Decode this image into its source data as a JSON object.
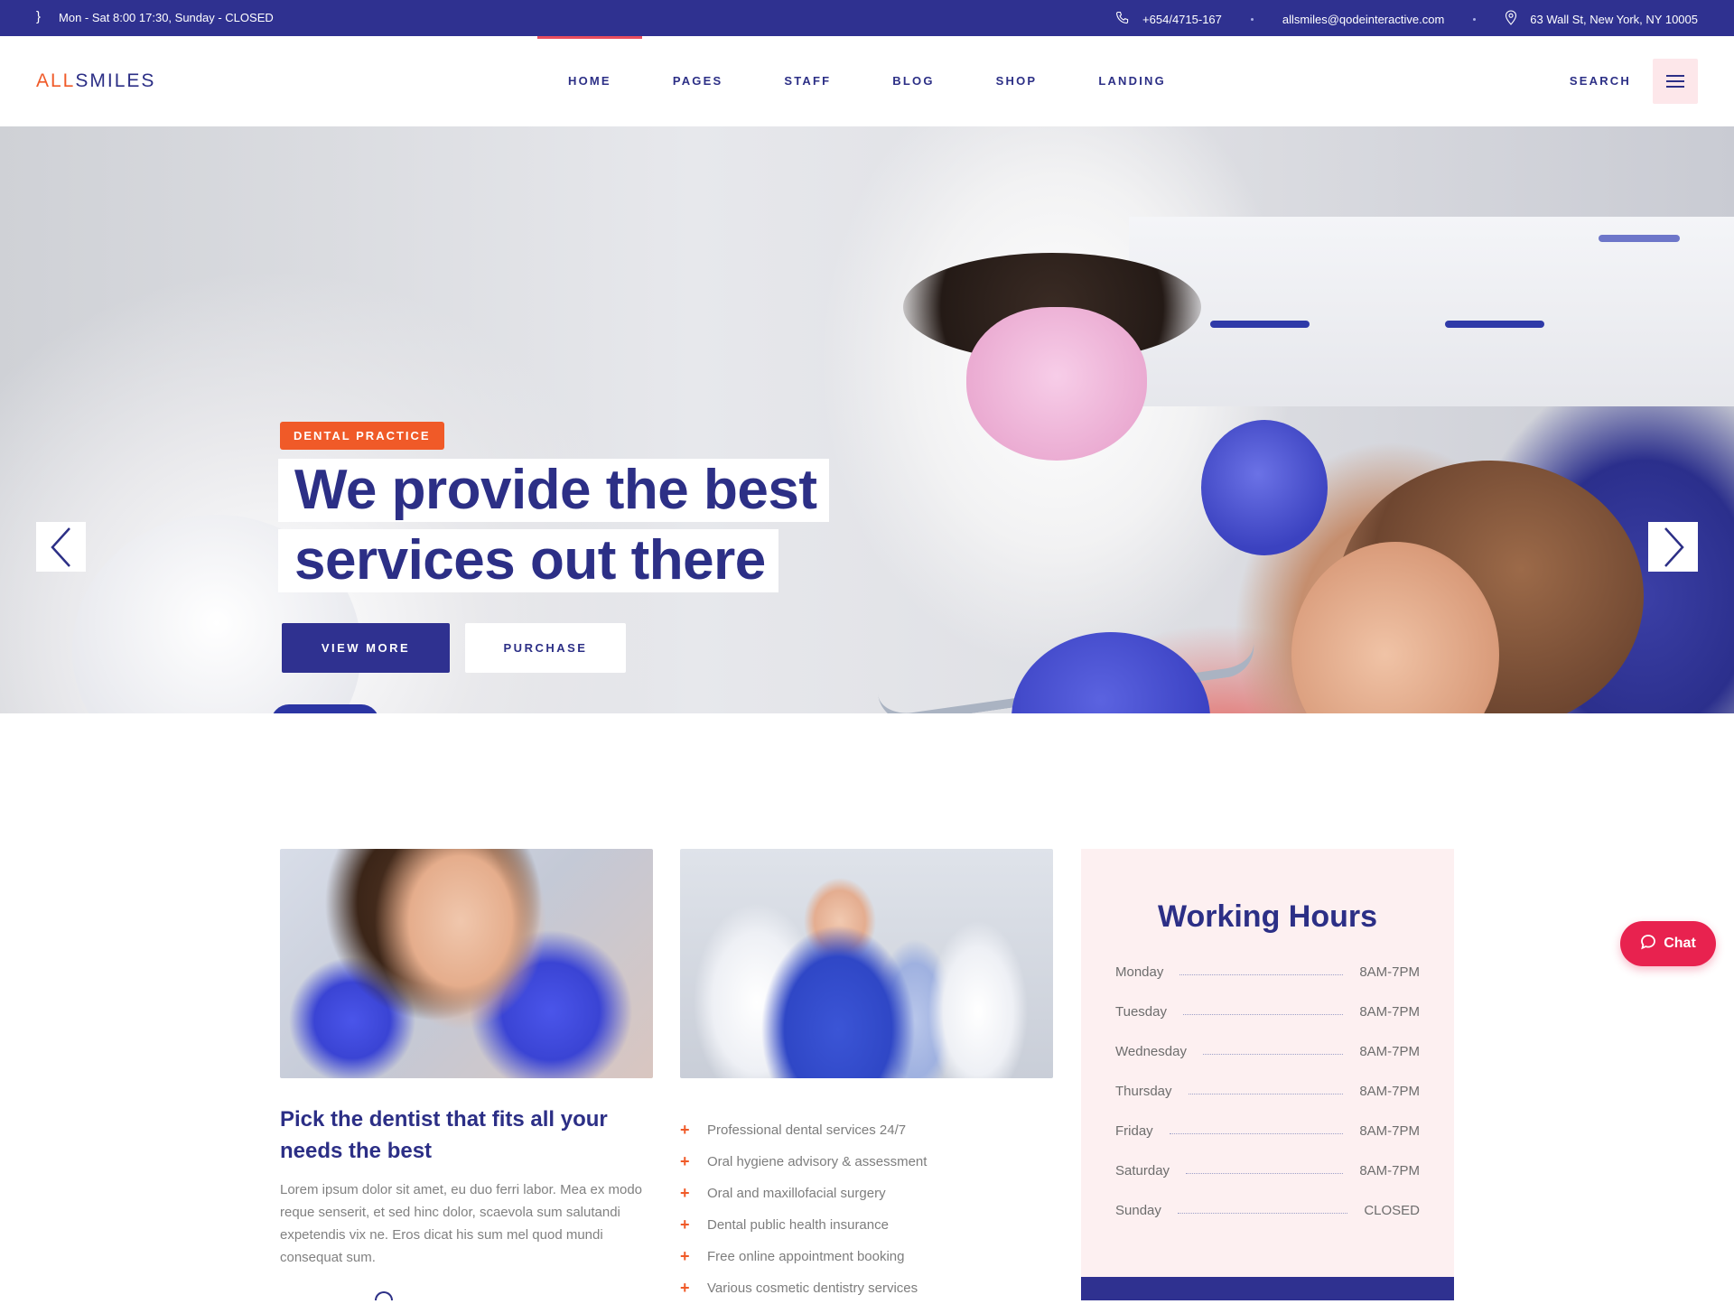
{
  "topbar": {
    "hours": "Mon - Sat 8:00 17:30, Sunday - CLOSED",
    "phone": "+654/4715-167",
    "email": "allsmiles@qodeinteractive.com",
    "address": "63 Wall St, New York, NY 10005"
  },
  "header": {
    "logo_part1": "ALL",
    "logo_part2": "SMILES",
    "nav": [
      "HOME",
      "PAGES",
      "STAFF",
      "BLOG",
      "SHOP",
      "LANDING"
    ],
    "active_nav": "HOME",
    "search_label": "SEARCH"
  },
  "hero": {
    "badge": "DENTAL PRACTICE",
    "title_line1": "We provide the best",
    "title_line2": "services out there",
    "primary_button": "VIEW MORE",
    "secondary_button": "PURCHASE",
    "slide_count": 4,
    "active_slide": 3
  },
  "card1": {
    "title": "Pick the dentist that fits all your needs the best",
    "text": "Lorem ipsum dolor sit amet, eu duo ferri labor. Mea ex modo reque senserit, et sed hinc dolor, scaevola sum salutandi expetendis vix ne. Eros dicat his sum mel quod mundi consequat sum."
  },
  "services": [
    "Professional dental services 24/7",
    "Oral hygiene advisory & assessment",
    "Oral and maxillofacial surgery",
    "Dental public health insurance",
    "Free online appointment booking",
    "Various cosmetic dentistry services"
  ],
  "working_hours": {
    "title": "Working Hours",
    "rows": [
      {
        "day": "Monday",
        "time": "8AM-7PM"
      },
      {
        "day": "Tuesday",
        "time": "8AM-7PM"
      },
      {
        "day": "Wednesday",
        "time": "8AM-7PM"
      },
      {
        "day": "Thursday",
        "time": "8AM-7PM"
      },
      {
        "day": "Friday",
        "time": "8AM-7PM"
      },
      {
        "day": "Saturday",
        "time": "8AM-7PM"
      },
      {
        "day": "Sunday",
        "time": "CLOSED"
      }
    ]
  },
  "chat": {
    "label": "Chat"
  },
  "colors": {
    "brand_navy": "#2f3190",
    "accent_orange": "#f05a28",
    "accent_pink": "#fdf0f1",
    "chat_red": "#e8224f"
  },
  "icons": {
    "phone": "phone-icon",
    "location": "location-pin-icon",
    "menu": "hamburger-menu-icon",
    "prev": "chevron-left-icon",
    "next": "chevron-right-icon",
    "chat": "chat-bubble-icon"
  }
}
